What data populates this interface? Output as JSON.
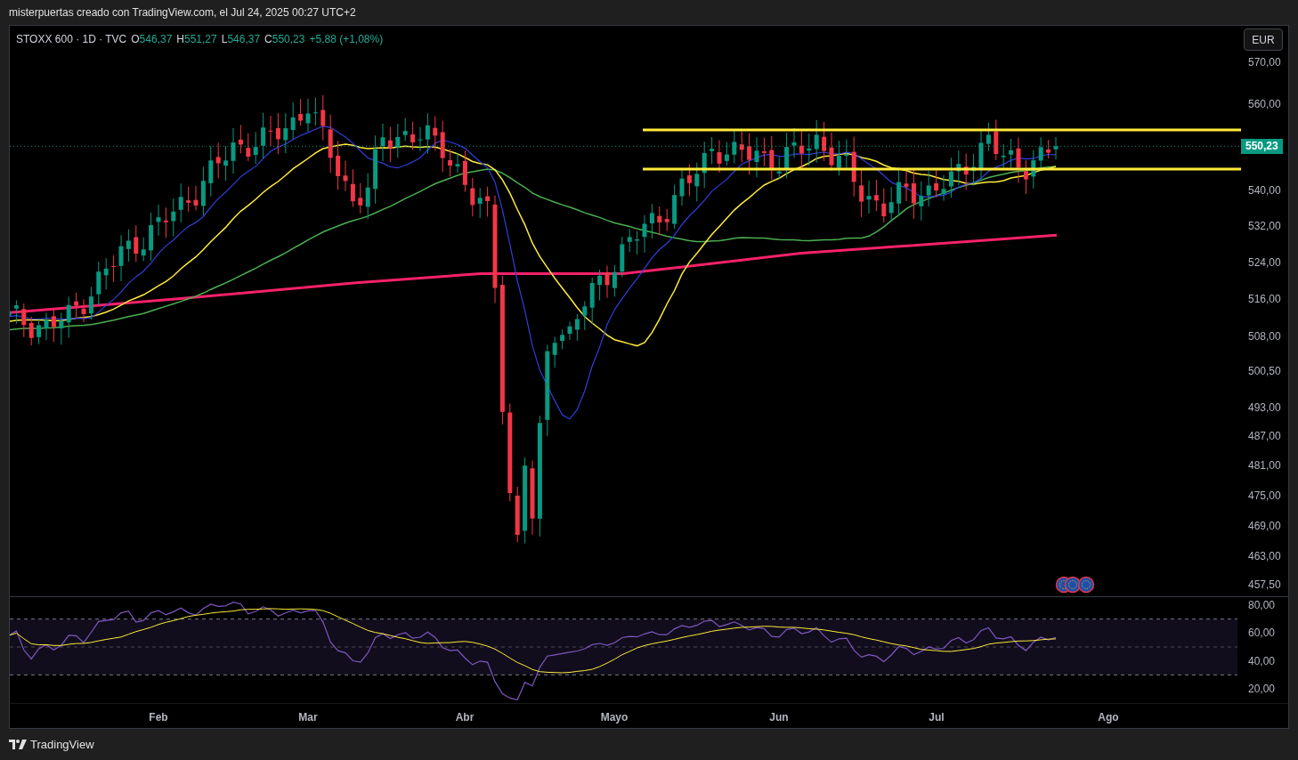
{
  "header": {
    "title": "misterpuertas creado con TradingView.com, el Jul 24, 2025 00:27 UTC+2"
  },
  "legend": {
    "symbol": "STOXX 600 · 1D · TVC",
    "ohlc": [
      {
        "label": "O",
        "value": "546,37"
      },
      {
        "label": "H",
        "value": "551,27"
      },
      {
        "label": "L",
        "value": "546,37"
      },
      {
        "label": "C",
        "value": "550,23"
      }
    ],
    "change": "+5,88 (+1,08%)"
  },
  "currency_button": "EUR",
  "price_axis": [
    "570,00",
    "560,00",
    "540,00",
    "532,00",
    "524,00",
    "516,00",
    "508,00",
    "500,50",
    "493,00",
    "487,00",
    "481,00",
    "475,00",
    "469,00",
    "463,00",
    "457,50"
  ],
  "current_price": "550,23",
  "rsi_axis": [
    "80,00",
    "60,00",
    "40,00",
    "20,00"
  ],
  "time_axis": [
    "Feb",
    "Mar",
    "Abr",
    "Mayo",
    "Jun",
    "Jul",
    "Ago"
  ],
  "footer": {
    "brand": "TradingView"
  }
}
